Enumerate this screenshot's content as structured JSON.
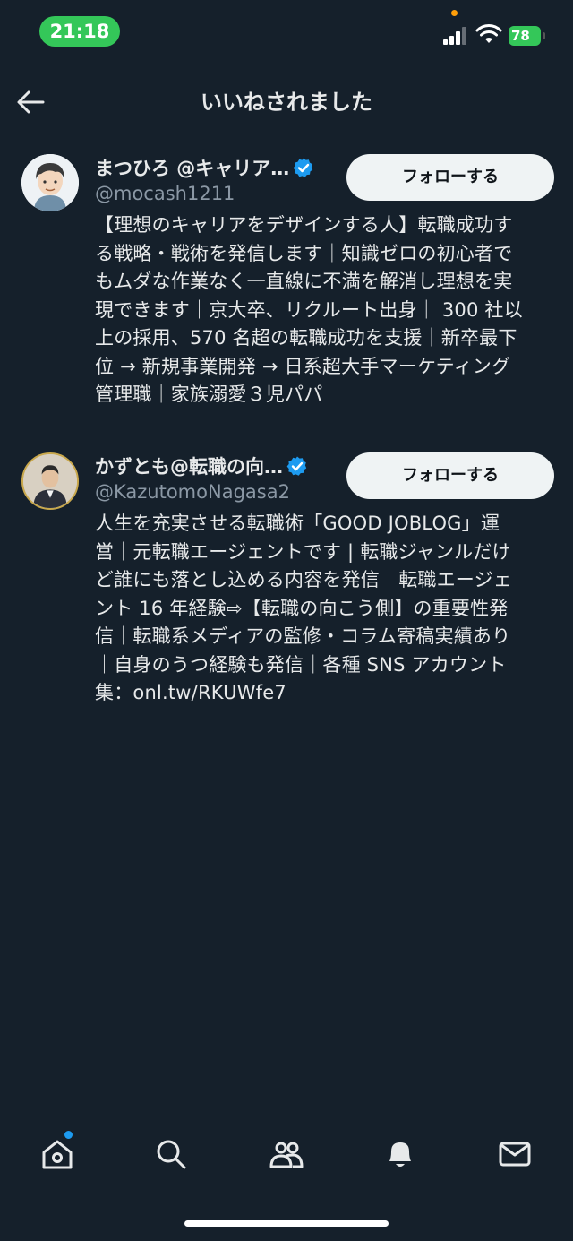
{
  "status_bar": {
    "time": "21:18",
    "battery": "78"
  },
  "header": {
    "title": "いいねされました"
  },
  "users": [
    {
      "display_name": "まつひろ @キャリア…",
      "handle": "@mocash1211",
      "follow_label": "フォローする",
      "bio_lines": [
        "【理想のキャリアをデザインする人】転職成功す",
        "る戦略・戦術を発信します｜知識ゼロの初心者で",
        "もムダな作業なく一直線に不満を解消し理想を実",
        "現できます｜京大卒、リクルート出身｜ 300 社以",
        "上の採用、570 名超の転職成功を支援｜新卒最下",
        "位 → 新規事業開発 → 日系超大手マーケティング",
        "管理職｜家族溺愛３児パパ"
      ]
    },
    {
      "display_name": "かずとも@転職の向…",
      "handle": "@KazutomoNagasa2",
      "follow_label": "フォローする",
      "bio_lines": [
        "人生を充実させる転職術「GOOD JOBLOG」運",
        "営｜元転職エージェントです | 転職ジャンルだけ",
        "ど誰にも落とし込める内容を発信｜転職エージェ",
        "ント 16 年経験⇨【転職の向こう側】の重要性発",
        "信｜転職系メディアの監修・コラム寄稿実績あり",
        "｜自身のうつ経験も発信｜各種 SNS アカウント",
        "集：onl.tw/RKUWfe7"
      ]
    }
  ],
  "bottom_nav": [
    "home-icon",
    "search-icon",
    "communities-icon",
    "notifications-icon",
    "messages-icon"
  ]
}
